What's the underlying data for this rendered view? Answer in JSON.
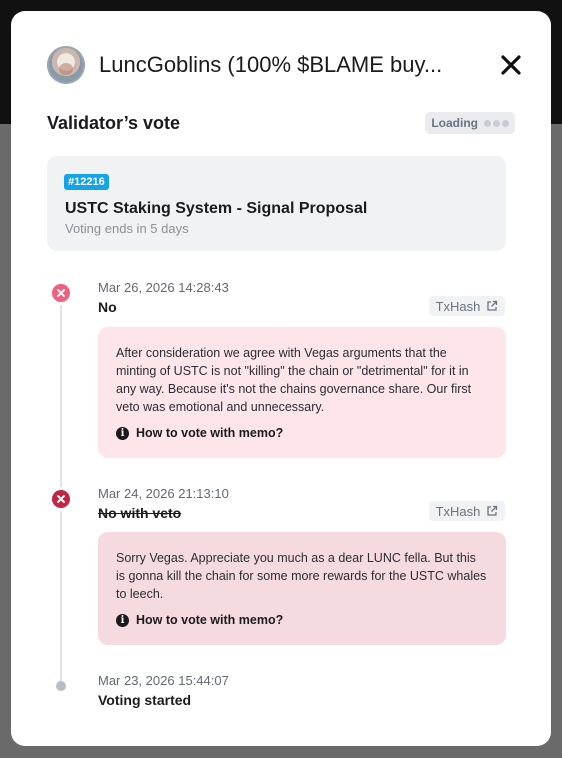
{
  "modal": {
    "title": "LuncGoblins (100% $BLAME buy...",
    "section_title": "Validator’s vote",
    "loading_label": "Loading"
  },
  "proposal": {
    "id_badge": "#12216",
    "title": "USTC Staking System - Signal Proposal",
    "subtitle": "Voting ends in 5 days"
  },
  "timeline": [
    {
      "date": "Mar 26, 2026 14:28:43",
      "vote": "No",
      "tx_label": "TxHash",
      "memo": "After consideration we agree with Vegas arguments that the minting of USTC is not \"killing\" the chain or \"detrimental\" for it in any way. Because it's not the chains governance share. Our first veto was emotional and unnecessary.",
      "help_label": "How to vote with memo?",
      "icon": "x-icon"
    },
    {
      "date": "Mar 24, 2026 21:13:10",
      "vote": "No with veto",
      "tx_label": "TxHash",
      "memo": "Sorry Vegas. Appreciate you much as a dear LUNC fella. But this is gonna kill the chain for some more rewards for the USTC whales to leech.",
      "help_label": "How to vote with memo?",
      "icon": "x-icon"
    },
    {
      "date": "Mar 23, 2026 15:44:07",
      "vote": "Voting started",
      "icon": "dot-icon"
    }
  ],
  "colors": {
    "no": "#f25f7e",
    "no_with_veto": "#c42543",
    "badge": "#14a3e6"
  }
}
